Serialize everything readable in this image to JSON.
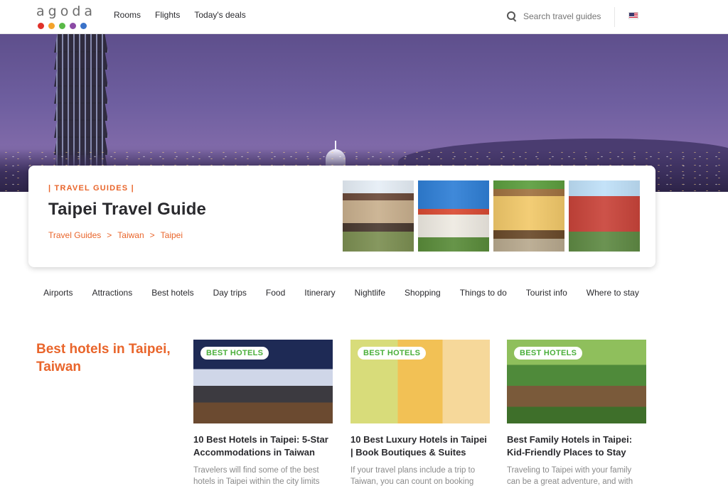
{
  "header": {
    "logo_text": "agoda",
    "logo_dot_colors": [
      "#e0312a",
      "#f4a32b",
      "#59b947",
      "#8b4aa5",
      "#3a72c9"
    ],
    "nav": [
      "Rooms",
      "Flights",
      "Today's deals"
    ],
    "search_placeholder": "Search travel guides",
    "language_flag": "us-flag-icon"
  },
  "hero": {
    "eyebrow": "| TRAVEL GUIDES |",
    "title": "Taipei Travel Guide",
    "breadcrumbs": [
      "Travel Guides",
      "Taiwan",
      "Taipei"
    ],
    "breadcrumb_separator": ">"
  },
  "tabs": [
    "Airports",
    "Attractions",
    "Best hotels",
    "Day trips",
    "Food",
    "Itinerary",
    "Nightlife",
    "Shopping",
    "Things to do",
    "Tourist info",
    "Where to stay"
  ],
  "section": {
    "title": "Best hotels in Taipei, Taiwan",
    "articles": [
      {
        "badge": "BEST HOTELS",
        "title": "10 Best Hotels in Taipei: 5-Star Accommodations in Taiwan",
        "desc": "Travelers will find some of the best hotels in Taipei within the city limits"
      },
      {
        "badge": "BEST HOTELS",
        "title": "10 Best Luxury Hotels in Taipei | Book Boutiques & Suites",
        "desc": "If your travel plans include a trip to Taiwan, you can count on booking"
      },
      {
        "badge": "BEST HOTELS",
        "title": "Best Family Hotels in Taipei: Kid-Friendly Places to Stay",
        "desc": "Traveling to Taipei with your family can be a great adventure, and with"
      }
    ]
  },
  "colors": {
    "accent_orange": "#e9652b",
    "badge_green": "#4aaf3a"
  }
}
